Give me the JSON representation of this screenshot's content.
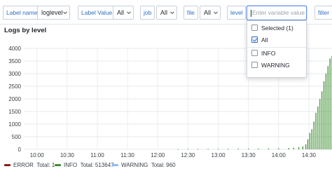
{
  "toolbar": {
    "label_name": {
      "label": "Label name",
      "value": "loglevel"
    },
    "label_value": {
      "label": "Label Value",
      "value": "All"
    },
    "job": {
      "label": "job",
      "value": "All"
    },
    "file": {
      "label": "file",
      "value": "All"
    },
    "level": {
      "label": "level",
      "placeholder": "Enter variable value"
    },
    "filter": {
      "label": "filter"
    }
  },
  "level_dropdown": {
    "items": [
      {
        "label": "Selected (1)",
        "checked": false
      },
      {
        "label": "All",
        "checked": true
      },
      {
        "label": "INFO",
        "checked": false
      },
      {
        "label": "WARNING",
        "checked": false
      }
    ]
  },
  "panel": {
    "title": "Logs by level"
  },
  "chart_data": {
    "type": "bar",
    "title": "Logs by level",
    "yticks": [
      "4000",
      "3500",
      "3000",
      "2500",
      "2000",
      "1500",
      "1000",
      "500",
      "0"
    ],
    "xticks": [
      "10:00",
      "10:30",
      "11:00",
      "11:30",
      "12:00",
      "12:30",
      "13:00",
      "13:30",
      "14:00",
      "14:30"
    ],
    "ylim": [
      0,
      4000
    ],
    "x_range": [
      "09:47",
      "14:53"
    ],
    "grid": true,
    "legend_position": "bottom",
    "series": [
      {
        "name": "ERROR",
        "total_label": "Total: 1",
        "color": "#8b1a1a"
      },
      {
        "name": "INFO",
        "total_label": "Total: 513647",
        "color": "#3c8f2f"
      },
      {
        "name": "WARNING",
        "total_label": "Total: 960",
        "color": "#8ab8ff"
      }
    ],
    "info_points": [
      [
        "12:20",
        12
      ],
      [
        "12:30",
        15
      ],
      [
        "12:40",
        18
      ],
      [
        "12:50",
        20
      ],
      [
        "13:00",
        22
      ],
      [
        "13:10",
        25
      ],
      [
        "13:20",
        28
      ],
      [
        "13:30",
        30
      ],
      [
        "13:40",
        32
      ],
      [
        "13:50",
        35
      ],
      [
        "14:00",
        40
      ],
      [
        "14:10",
        50
      ],
      [
        "14:15",
        60
      ],
      [
        "14:20",
        80
      ],
      [
        "14:24",
        120
      ],
      [
        "14:27",
        200
      ],
      [
        "14:29",
        400
      ],
      [
        "14:31",
        650
      ],
      [
        "14:33",
        800
      ],
      [
        "14:35",
        1100
      ],
      [
        "14:37",
        1450
      ],
      [
        "14:39",
        1700
      ],
      [
        "14:41",
        2000
      ],
      [
        "14:43",
        2300
      ],
      [
        "14:45",
        2700
      ],
      [
        "14:47",
        3000
      ],
      [
        "14:49",
        3300
      ],
      [
        "14:51",
        3600
      ],
      [
        "14:53",
        3700
      ]
    ]
  }
}
